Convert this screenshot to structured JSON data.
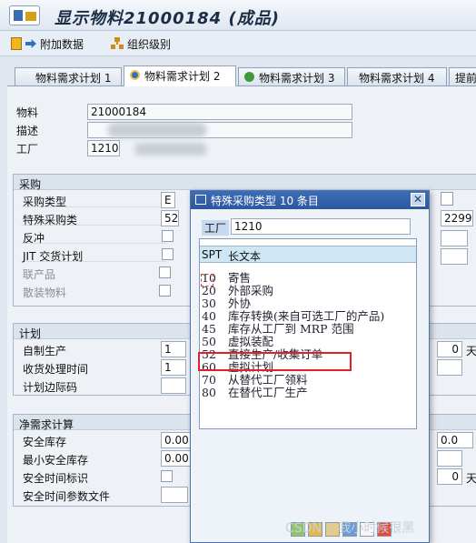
{
  "window": {
    "title": "显示物料21000184 (成品)"
  },
  "toolbar": {
    "additional_data": "附加数据",
    "org_levels": "组织级别"
  },
  "tabs": [
    "物料需求计划 1",
    "物料需求计划 2",
    "物料需求计划 3",
    "物料需求计划 4",
    "提前"
  ],
  "header": {
    "material_label": "物料",
    "material_value": "21000184",
    "desc_label": "描述",
    "plant_label": "工厂",
    "plant_value": "1210"
  },
  "procurement": {
    "title": "采购",
    "proc_type_label": "采购类型",
    "proc_type_value": "E",
    "special_label": "特殊采购类",
    "special_value": "52",
    "backflush_label": "反冲",
    "jit_label": "JIT 交货计划",
    "coproduct_label": "联产品",
    "bulk_label": "散装物料",
    "right_value": "2299"
  },
  "planning": {
    "title": "计划",
    "inhouse_label": "自制生产",
    "inhouse_value": "1",
    "gr_label": "收货处理时间",
    "gr_value": "1",
    "margin_label": "计划边际码",
    "right_value": "0",
    "day_unit": "天"
  },
  "net": {
    "title": "净需求计算",
    "safety_label": "安全库存",
    "safety_value": "0.00",
    "min_safety_label": "最小安全库存",
    "min_safety_value": "0.00",
    "time_ind_label": "安全时间标识",
    "time_profile_label": "安全时间参数文件",
    "right_value": "0.0",
    "right_value2": "0",
    "day_unit": "天"
  },
  "dialog": {
    "title": "特殊采购类型 10 条目",
    "plant_label": "工厂",
    "plant_value": "1210",
    "col_spt": "SPT",
    "col_text": "长文本",
    "rows": [
      {
        "code": "10",
        "text": "寄售"
      },
      {
        "code": "20",
        "text": "外部采购"
      },
      {
        "code": "30",
        "text": "外协"
      },
      {
        "code": "40",
        "text": "库存转换(来自可选工厂的产品)"
      },
      {
        "code": "45",
        "text": "库存从工厂到 MRP 范围"
      },
      {
        "code": "50",
        "text": "虚拟装配"
      },
      {
        "code": "52",
        "text": "直接生产/收集订单"
      },
      {
        "code": "60",
        "text": "虚拟计划"
      },
      {
        "code": "70",
        "text": "从替代工厂领料"
      },
      {
        "code": "80",
        "text": "在替代工厂生产"
      }
    ]
  },
  "watermark": "CSDN @我小时候很黑",
  "colors": {
    "highlight": "#e0202a",
    "dialog_header": "#2c57a0"
  }
}
